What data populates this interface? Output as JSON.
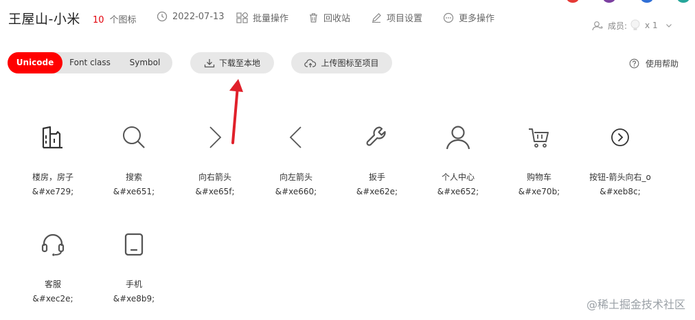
{
  "header": {
    "project_title": "王屋山-小米",
    "icon_count": "10",
    "icon_count_unit": "个图标",
    "date": "2022-07-13",
    "actions": [
      {
        "label": "批量操作",
        "icon": "batch-grid-icon"
      },
      {
        "label": "回收站",
        "icon": "trash-icon"
      },
      {
        "label": "项目设置",
        "icon": "pencil-icon"
      },
      {
        "label": "更多操作",
        "icon": "more-dots-icon"
      }
    ],
    "members_label": "成员:",
    "members_count": "x 1"
  },
  "toolbar": {
    "tabs": [
      {
        "label": "Unicode",
        "active": true
      },
      {
        "label": "Font class",
        "active": false
      },
      {
        "label": "Symbol",
        "active": false
      }
    ],
    "download_label": "下载至本地",
    "upload_label": "上传图标至项目",
    "help_label": "使用帮助"
  },
  "icons": [
    {
      "name": "楼房，房子",
      "code": "&#xe729;",
      "icon": "building-icon"
    },
    {
      "name": "搜索",
      "code": "&#xe651;",
      "icon": "search-icon"
    },
    {
      "name": "向右箭头",
      "code": "&#xe65f;",
      "icon": "arrow-right-icon"
    },
    {
      "name": "向左箭头",
      "code": "&#xe660;",
      "icon": "arrow-left-icon"
    },
    {
      "name": "扳手",
      "code": "&#xe62e;",
      "icon": "wrench-icon"
    },
    {
      "name": "个人中心",
      "code": "&#xe652;",
      "icon": "user-icon"
    },
    {
      "name": "购物车",
      "code": "&#xe70b;",
      "icon": "cart-icon"
    },
    {
      "name": "按钮-箭头向右_o",
      "code": "&#xeb8c;",
      "icon": "circle-arrow-right-icon"
    },
    {
      "name": "客服",
      "code": "&#xec2e;",
      "icon": "headset-icon"
    },
    {
      "name": "手机",
      "code": "&#xe8b9;",
      "icon": "phone-icon"
    }
  ],
  "watermark": "@稀土掘金技术社区",
  "colors": {
    "accent": "#ff0000",
    "count_red": "#e3000b",
    "annotation_arrow": "#e0202a"
  }
}
